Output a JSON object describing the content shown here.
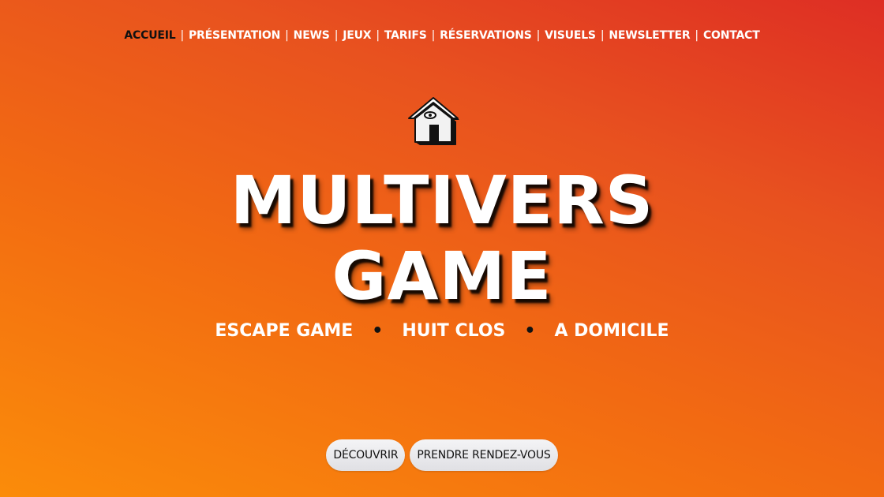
{
  "nav": {
    "items": [
      {
        "label": "ACCUEIL",
        "active": true
      },
      {
        "label": "PRÉSENTATION"
      },
      {
        "label": "NEWS"
      },
      {
        "label": "JEUX"
      },
      {
        "label": "TARIFS"
      },
      {
        "label": "RÉSERVATIONS"
      },
      {
        "label": "VISUELS"
      },
      {
        "label": "NEWSLETTER"
      },
      {
        "label": "CONTACT"
      }
    ],
    "separator": "|"
  },
  "logo": {
    "icon": "house-eye-logo"
  },
  "hero": {
    "title_line1": "MULTIVERS",
    "title_line2": "GAME",
    "tagline": [
      "ESCAPE GAME",
      "HUIT CLOS",
      "A DOMICILE"
    ],
    "tagline_separator": "•"
  },
  "buttons": {
    "discover": "DÉCOUVRIR",
    "appointment": "PRENDRE RENDEZ-VOUS"
  },
  "colors": {
    "background_start": "#fb8c0a",
    "background_end": "#de2e24",
    "text": "#ffffff",
    "active_nav": "#111111"
  }
}
